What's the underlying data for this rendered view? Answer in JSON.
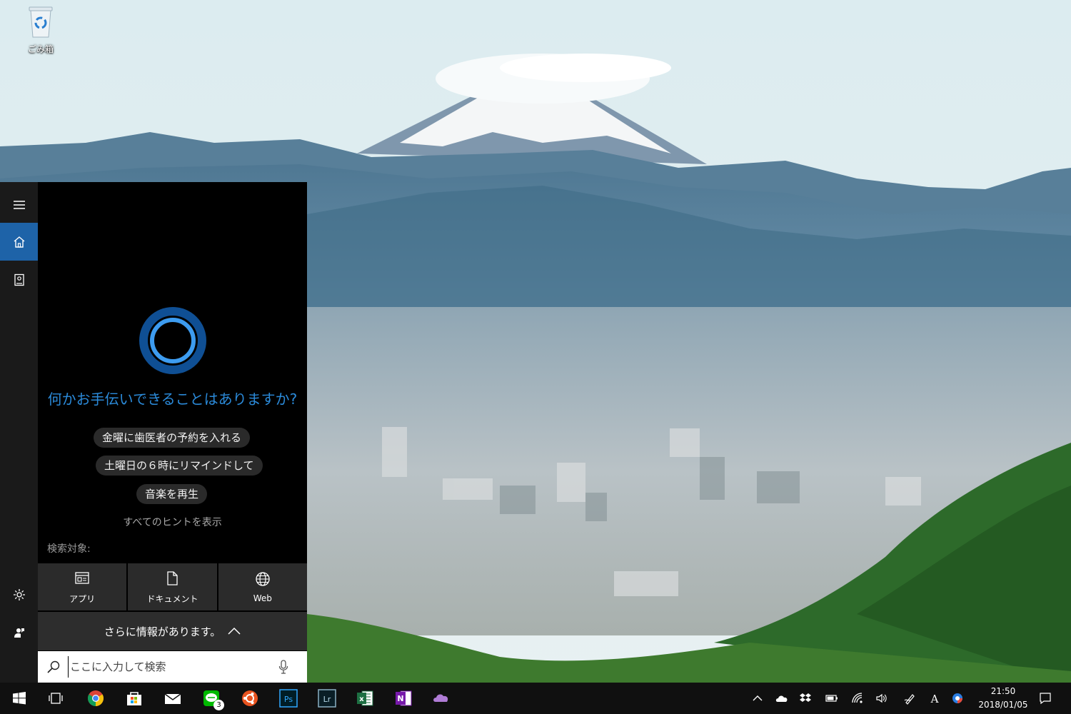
{
  "desktop": {
    "recycle_bin_label": "ごみ箱"
  },
  "cortana": {
    "rail": [
      "menu-icon",
      "home-icon",
      "notebook-icon",
      "settings-icon",
      "feedback-icon"
    ],
    "prompt": "何かお手伝いできることはありますか?",
    "suggestions": [
      "金曜に歯医者の予約を入れる",
      "土曜日の６時にリマインドして",
      "音楽を再生"
    ],
    "show_all_hints": "すべてのヒントを表示",
    "search_scope_label": "検索対象:",
    "scopes": [
      {
        "label": "アプリ",
        "icon": "apps-icon"
      },
      {
        "label": "ドキュメント",
        "icon": "document-icon"
      },
      {
        "label": "Web",
        "icon": "globe-icon"
      }
    ],
    "more_info": "さらに情報があります。",
    "search": {
      "placeholder": "ここに入力して検索",
      "value": ""
    },
    "accent_color": "#2b8ad9"
  },
  "taskbar": {
    "apps": [
      "start",
      "task-view",
      "chrome",
      "store",
      "mail",
      "line",
      "ubuntu",
      "photoshop",
      "lightroom",
      "excel",
      "onenote",
      "onedrive"
    ],
    "line_badge": "3",
    "ps_label": "Ps",
    "lr_label": "Lr",
    "excel_label": "x",
    "onenote_label": "N",
    "tray_icons": [
      "chevron-up-icon",
      "onedrive-icon",
      "dropbox-icon",
      "battery-icon",
      "wifi-icon",
      "volume-icon",
      "pen-icon",
      "ime-icon",
      "app-icon"
    ],
    "ime_label": "A",
    "time": "21:50",
    "date": "2018/01/05"
  }
}
